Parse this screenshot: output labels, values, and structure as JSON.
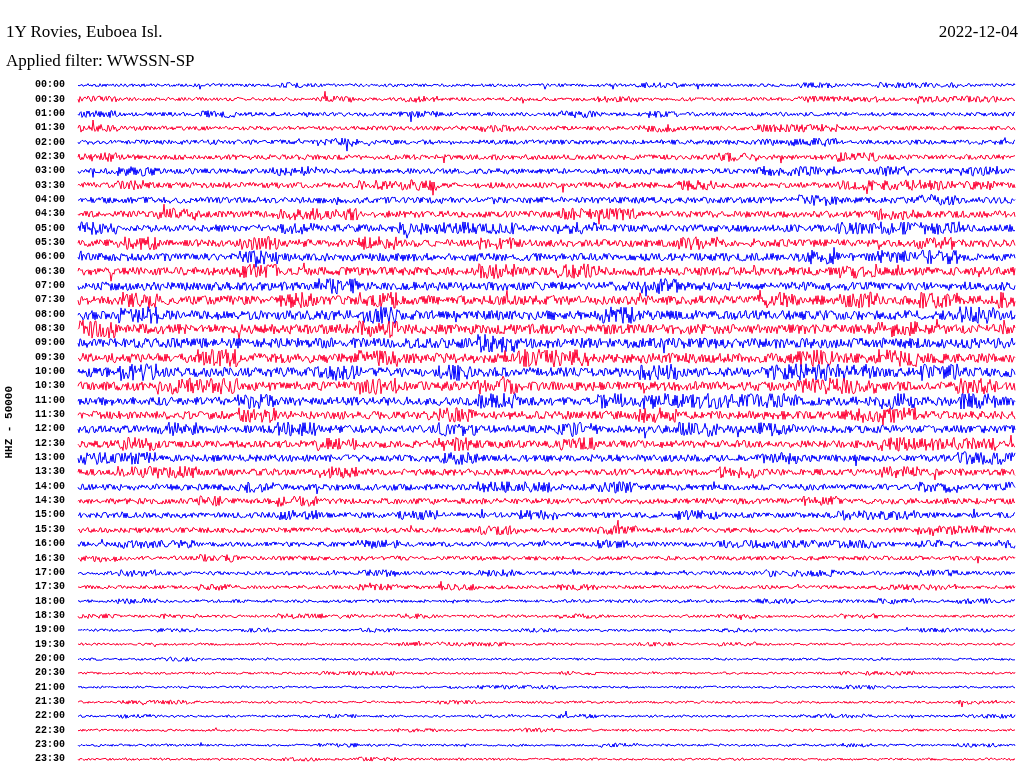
{
  "header": {
    "station": "1Y Rovies, Euboea Isl.",
    "date": "2022-12-04",
    "filter": "Applied filter: WWSSN-SP"
  },
  "channel_label": "HHZ - 50000",
  "rows": [
    {
      "time": "00:00",
      "color": "#0000ff"
    },
    {
      "time": "00:30",
      "color": "#ff0033"
    },
    {
      "time": "01:00",
      "color": "#0000ff"
    },
    {
      "time": "01:30",
      "color": "#ff0033"
    },
    {
      "time": "02:00",
      "color": "#0000ff"
    },
    {
      "time": "02:30",
      "color": "#ff0033"
    },
    {
      "time": "03:00",
      "color": "#0000ff"
    },
    {
      "time": "03:30",
      "color": "#ff0033"
    },
    {
      "time": "04:00",
      "color": "#0000ff"
    },
    {
      "time": "04:30",
      "color": "#ff0033"
    },
    {
      "time": "05:00",
      "color": "#0000ff"
    },
    {
      "time": "05:30",
      "color": "#ff0033"
    },
    {
      "time": "06:00",
      "color": "#0000ff"
    },
    {
      "time": "06:30",
      "color": "#ff0033"
    },
    {
      "time": "07:00",
      "color": "#0000ff"
    },
    {
      "time": "07:30",
      "color": "#ff0033"
    },
    {
      "time": "08:00",
      "color": "#0000ff"
    },
    {
      "time": "08:30",
      "color": "#ff0033"
    },
    {
      "time": "09:00",
      "color": "#0000ff"
    },
    {
      "time": "09:30",
      "color": "#ff0033"
    },
    {
      "time": "10:00",
      "color": "#0000ff"
    },
    {
      "time": "10:30",
      "color": "#ff0033"
    },
    {
      "time": "11:00",
      "color": "#0000ff"
    },
    {
      "time": "11:30",
      "color": "#ff0033"
    },
    {
      "time": "12:00",
      "color": "#0000ff"
    },
    {
      "time": "12:30",
      "color": "#ff0033"
    },
    {
      "time": "13:00",
      "color": "#0000ff"
    },
    {
      "time": "13:30",
      "color": "#ff0033"
    },
    {
      "time": "14:00",
      "color": "#0000ff"
    },
    {
      "time": "14:30",
      "color": "#ff0033"
    },
    {
      "time": "15:00",
      "color": "#0000ff"
    },
    {
      "time": "15:30",
      "color": "#ff0033"
    },
    {
      "time": "16:00",
      "color": "#0000ff"
    },
    {
      "time": "16:30",
      "color": "#ff0033"
    },
    {
      "time": "17:00",
      "color": "#0000ff"
    },
    {
      "time": "17:30",
      "color": "#ff0033"
    },
    {
      "time": "18:00",
      "color": "#0000ff"
    },
    {
      "time": "18:30",
      "color": "#ff0033"
    },
    {
      "time": "19:00",
      "color": "#0000ff"
    },
    {
      "time": "19:30",
      "color": "#ff0033"
    },
    {
      "time": "20:00",
      "color": "#0000ff"
    },
    {
      "time": "20:30",
      "color": "#ff0033"
    },
    {
      "time": "21:00",
      "color": "#0000ff"
    },
    {
      "time": "21:30",
      "color": "#ff0033"
    },
    {
      "time": "22:00",
      "color": "#0000ff"
    },
    {
      "time": "22:30",
      "color": "#ff0033"
    },
    {
      "time": "23:00",
      "color": "#0000ff"
    },
    {
      "time": "23:30",
      "color": "#ff0033"
    }
  ]
}
